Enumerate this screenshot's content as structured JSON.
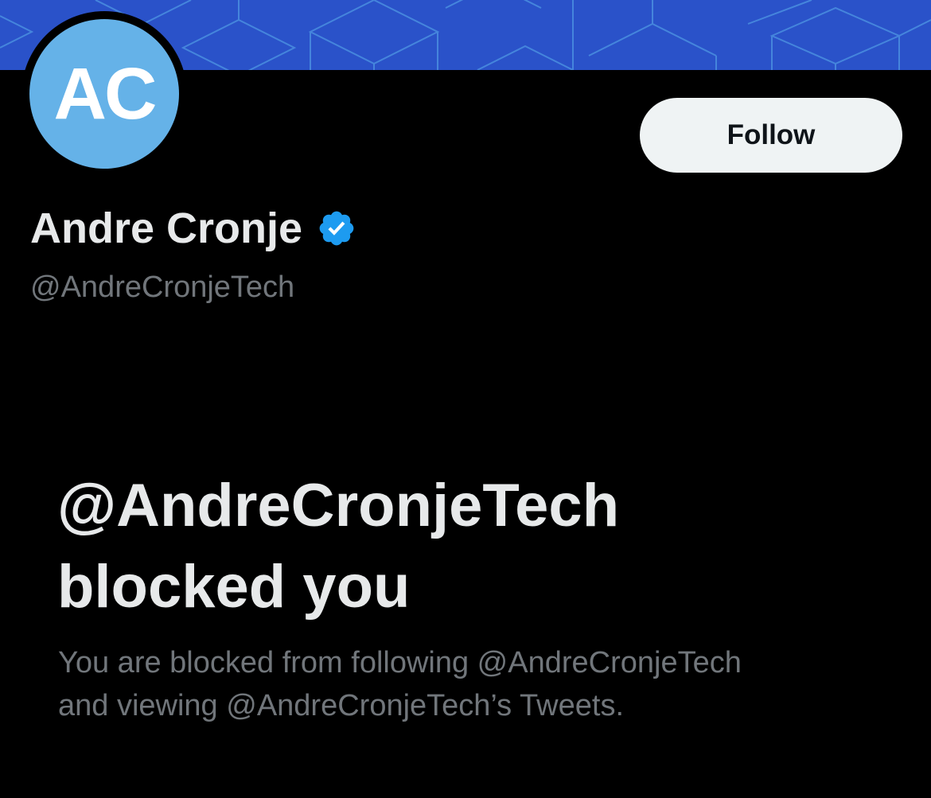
{
  "profile": {
    "avatar_initials": "AC",
    "display_name": "Andre Cronje",
    "handle": "@AndreCronjeTech",
    "verified_icon": "verified-badge-icon"
  },
  "actions": {
    "follow_label": "Follow"
  },
  "blocked": {
    "title_line1": "@AndreCronjeTech",
    "title_line2": "blocked you",
    "description_line1": "You are blocked from following @AndreCronjeTech",
    "description_line2": "and viewing @AndreCronjeTech’s Tweets."
  },
  "colors": {
    "banner": "#2a52c9",
    "avatar": "#65b2e8",
    "verified": "#1d9bf0",
    "background": "#000000",
    "secondary_text": "#71767b"
  }
}
